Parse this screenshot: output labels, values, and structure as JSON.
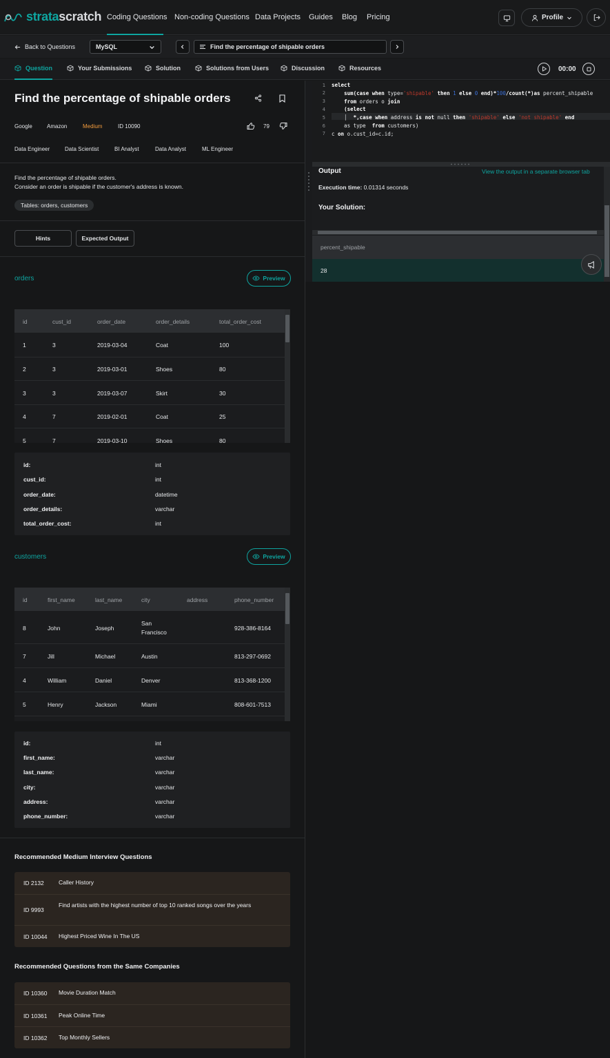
{
  "brand": {
    "part1": "strata",
    "part2": "scratch"
  },
  "nav": {
    "items": [
      "Coding Questions",
      "Non-coding Questions",
      "Data Projects",
      "Guides",
      "Blog",
      "Pricing"
    ],
    "profile": "Profile"
  },
  "subbar": {
    "back": "Back to Questions",
    "language": "MySQL",
    "question_title": "Find the percentage of shipable orders"
  },
  "tabs": [
    "Question",
    "Your Submissions",
    "Solution",
    "Solutions from Users",
    "Discussion",
    "Resources"
  ],
  "timer": "00:00",
  "question": {
    "title": "Find the percentage of shipable orders",
    "companies": [
      "Google",
      "Amazon"
    ],
    "difficulty": "Medium",
    "id": "ID 10090",
    "votes": "79",
    "roles": [
      "Data Engineer",
      "Data Scientist",
      "BI Analyst",
      "Data Analyst",
      "ML Engineer"
    ],
    "description_1": "Find the percentage of shipable orders.",
    "description_2": "Consider an order is shipable if the customer's address is known.",
    "tables_pill": "Tables: orders, customers",
    "hints_button": "Hints",
    "expected_button": "Expected Output"
  },
  "orders": {
    "name": "orders",
    "preview": "Preview",
    "columns": [
      "id",
      "cust_id",
      "order_date",
      "order_details",
      "total_order_cost"
    ],
    "rows": [
      [
        "1",
        "3",
        "2019-03-04",
        "Coat",
        "100"
      ],
      [
        "2",
        "3",
        "2019-03-01",
        "Shoes",
        "80"
      ],
      [
        "3",
        "3",
        "2019-03-07",
        "Skirt",
        "30"
      ],
      [
        "4",
        "7",
        "2019-02-01",
        "Coat",
        "25"
      ],
      [
        "5",
        "7",
        "2019-03-10",
        "Shoes",
        "80"
      ]
    ],
    "schema": [
      {
        "col": "id:",
        "type": "int"
      },
      {
        "col": "cust_id:",
        "type": "int"
      },
      {
        "col": "order_date:",
        "type": "datetime"
      },
      {
        "col": "order_details:",
        "type": "varchar"
      },
      {
        "col": "total_order_cost:",
        "type": "int"
      }
    ]
  },
  "customers": {
    "name": "customers",
    "preview": "Preview",
    "columns": [
      "id",
      "first_name",
      "last_name",
      "city",
      "address",
      "phone_number"
    ],
    "rows": [
      [
        "8",
        "John",
        "Joseph",
        "San Francisco",
        "",
        "928-386-8164"
      ],
      [
        "7",
        "Jill",
        "Michael",
        "Austin",
        "",
        "813-297-0692"
      ],
      [
        "4",
        "William",
        "Daniel",
        "Denver",
        "",
        "813-368-1200"
      ],
      [
        "5",
        "Henry",
        "Jackson",
        "Miami",
        "",
        "808-601-7513"
      ]
    ],
    "schema": [
      {
        "col": "id:",
        "type": "int"
      },
      {
        "col": "first_name:",
        "type": "varchar"
      },
      {
        "col": "last_name:",
        "type": "varchar"
      },
      {
        "col": "city:",
        "type": "varchar"
      },
      {
        "col": "address:",
        "type": "varchar"
      },
      {
        "col": "phone_number:",
        "type": "varchar"
      }
    ]
  },
  "recommended_medium": {
    "title": "Recommended Medium Interview Questions",
    "items": [
      {
        "id": "ID 2132",
        "name": "Caller History"
      },
      {
        "id": "ID 9993",
        "name": "Find artists with the highest number of top 10 ranked songs over the years"
      },
      {
        "id": "ID 10044",
        "name": "Highest Priced Wine In The US"
      }
    ]
  },
  "recommended_company": {
    "title": "Recommended Questions from the Same Companies",
    "items": [
      {
        "id": "ID 10360",
        "name": "Movie Duration Match"
      },
      {
        "id": "ID 10361",
        "name": "Peak Online Time"
      },
      {
        "id": "ID 10362",
        "name": "Top Monthly Sellers"
      }
    ]
  },
  "editor": {
    "line_numbers": [
      "1",
      "2",
      "3",
      "4",
      "5",
      "6",
      "7"
    ],
    "lines": [
      [
        {
          "t": "select",
          "c": "kw"
        }
      ],
      [
        {
          "t": "    "
        },
        {
          "t": "sum",
          "c": "kw"
        },
        {
          "t": "(",
          "c": "kw"
        },
        {
          "t": "case when",
          "c": "kw"
        },
        {
          "t": " type="
        },
        {
          "t": "'shipable'",
          "c": "str"
        },
        {
          "t": " "
        },
        {
          "t": "then",
          "c": "kw"
        },
        {
          "t": " "
        },
        {
          "t": "1",
          "c": "num"
        },
        {
          "t": " "
        },
        {
          "t": "else",
          "c": "kw"
        },
        {
          "t": " "
        },
        {
          "t": "0",
          "c": "num"
        },
        {
          "t": " "
        },
        {
          "t": "end)*",
          "c": "kw"
        },
        {
          "t": "100",
          "c": "num"
        },
        {
          "t": "/count(*)",
          "c": "kw"
        },
        {
          "t": "as",
          "c": "kw"
        },
        {
          "t": " percent_shipable"
        }
      ],
      [
        {
          "t": "    "
        },
        {
          "t": "from",
          "c": "kw"
        },
        {
          "t": " orders o "
        },
        {
          "t": "join",
          "c": "kw"
        }
      ],
      [
        {
          "t": "    "
        },
        {
          "t": "(select",
          "c": "kw"
        }
      ],
      [
        {
          "t": "    │  "
        },
        {
          "t": "*,",
          "c": "kw"
        },
        {
          "t": "case when",
          "c": "kw"
        },
        {
          "t": " address "
        },
        {
          "t": "is not",
          "c": "kw"
        },
        {
          "t": " null "
        },
        {
          "t": "then",
          "c": "kw"
        },
        {
          "t": " "
        },
        {
          "t": "'shipable'",
          "c": "str"
        },
        {
          "t": " "
        },
        {
          "t": "else",
          "c": "kw"
        },
        {
          "t": " "
        },
        {
          "t": "'not shipable'",
          "c": "str"
        },
        {
          "t": " "
        },
        {
          "t": "end",
          "c": "kw"
        }
      ],
      [
        {
          "t": "    as type  "
        },
        {
          "t": "from",
          "c": "kw"
        },
        {
          "t": " customers)"
        }
      ],
      [
        {
          "t": "c "
        },
        {
          "t": "on",
          "c": "kw"
        },
        {
          "t": " o.cust_id=c.id;"
        }
      ]
    ]
  },
  "output": {
    "title": "Output",
    "link": "View the output in a separate browser tab",
    "exec_label": "Execution time:",
    "exec_value": "0.01314 seconds",
    "your_solution": "Your Solution:",
    "column": "percent_shipable",
    "value": "28"
  },
  "colors": {
    "accent": "#0ea5a0",
    "medium": "#f39c3d"
  }
}
